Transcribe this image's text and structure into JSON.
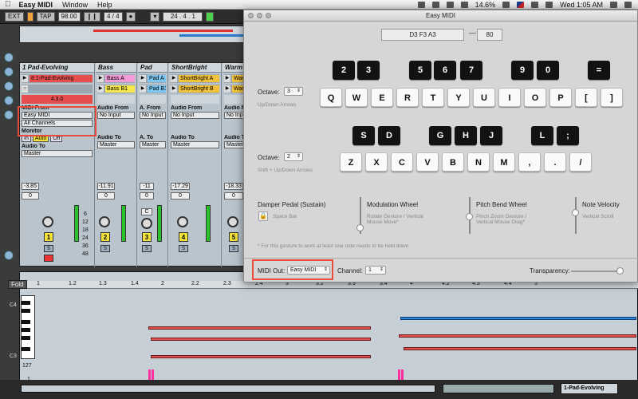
{
  "menubar": {
    "app_name": "Easy MIDI",
    "menus": [
      "Window",
      "Help"
    ],
    "battery": "14.6%",
    "clock": "Wed 1:05 AM"
  },
  "transport": {
    "ext": "EXT",
    "tap": "TAP",
    "tempo": "98.00",
    "signature": "4 / 4",
    "loop_state": "●",
    "position": "24 . 4 . 1"
  },
  "tracks": [
    {
      "name": "1 Pad-Evolving",
      "clip1": "8 1-Pad-Evolving",
      "clip2": "",
      "midi_from_label": "MIDI From",
      "midi_from": "Easy MIDI",
      "channel": "All Channels",
      "monitor_label": "Monitor",
      "monitor": [
        "In",
        "Auto",
        "Off"
      ],
      "audio_to_label": "Audio To",
      "audio_to": "Master",
      "db": "-3.85",
      "pan": "0",
      "number": "1",
      "solo": "S",
      "counter": "4.3.0",
      "scale": [
        "6",
        "12",
        "18",
        "24",
        "36",
        "48"
      ]
    },
    {
      "name": "Bass",
      "clip1": "Bass A",
      "clip2": "Bass B1",
      "midi_from_label": "Audio From",
      "midi_from": "No Input",
      "audio_to_label": "Audio To",
      "audio_to": "Master",
      "db": "-11.91",
      "pan": "0",
      "number": "2",
      "solo": "S"
    },
    {
      "name": "Pad",
      "clip1": "Pad A",
      "clip2": "Pad B1",
      "midi_from_label": "A. From",
      "midi_from": "No Input",
      "audio_to_label": "A. To",
      "audio_to": "Master",
      "db": "-11",
      "pan": "0",
      "number": "3",
      "solo": "S",
      "mode": "C"
    },
    {
      "name": "ShortBright",
      "clip1": "ShortBright A",
      "clip2": "ShortBright B",
      "midi_from_label": "Audio From",
      "midi_from": "No Input",
      "audio_to_label": "Audio To",
      "audio_to": "Master",
      "db": "-17.29",
      "pan": "0",
      "number": "4",
      "solo": "S"
    },
    {
      "name": "Warm",
      "clip1": "Warm",
      "clip2": "Warm",
      "midi_from_label": "Audio From",
      "midi_from": "No Input",
      "audio_to_label": "Audio To",
      "audio_to": "Master",
      "db": "-18.33",
      "pan": "0",
      "number": "5",
      "solo": "S"
    }
  ],
  "pianoroll": {
    "fold": "Fold",
    "ruler": [
      "1",
      "1.2",
      "1.3",
      "1.4",
      "2",
      "2.2",
      "2.3",
      "2.4",
      "3",
      "3.2",
      "3.3",
      "3.4",
      "4",
      "4.2",
      "4.3",
      "4.4",
      "5"
    ],
    "row_labels": {
      "upper": "C4",
      "lower": "C3"
    },
    "velocity_labels": {
      "top": "127",
      "bottom": "1"
    }
  },
  "clip_name_tag": "1-Pad-Evolving",
  "easymidi": {
    "title": "Easy MIDI",
    "notes_display": "D3 F3 A3",
    "dash": "—",
    "velocity_display": "80",
    "octave_label": "Octave:",
    "octave1": "3",
    "octave1_hint": "Up/Down Arrows",
    "octave2": "2",
    "octave2_hint": "Shift + Up/Down Arrows",
    "row1_black": [
      "2",
      "3",
      "5",
      "6",
      "7",
      "9",
      "0",
      "="
    ],
    "row1_white": [
      "Q",
      "W",
      "E",
      "R",
      "T",
      "Y",
      "U",
      "I",
      "O",
      "P",
      "[",
      "]"
    ],
    "row2_black": [
      "S",
      "D",
      "G",
      "H",
      "J",
      "L",
      ";"
    ],
    "row2_white": [
      "Z",
      "X",
      "C",
      "V",
      "B",
      "N",
      "M",
      ",",
      ".",
      "/"
    ],
    "damper_label": "Damper Pedal (Sustain)",
    "damper_hint": "Space Bar",
    "mod_label": "Modulation Wheel",
    "mod_hint": "Rotate Gesture / Vertical Mouse Move*",
    "pitch_label": "Pitch Bend Wheel",
    "pitch_hint": "Pinch Zoom Gesture / Vertical Mouse Drag*",
    "velocity_label": "Note Velocity",
    "velocity_hint": "Vertical Scroll",
    "gesture_note": "* For this gesture to work at least one note needs to be held down.",
    "midi_out_label": "MIDI Out:",
    "midi_out": "Easy MIDI",
    "channel_label": "Channel:",
    "channel": "1",
    "transparency_label": "Transparency:"
  }
}
